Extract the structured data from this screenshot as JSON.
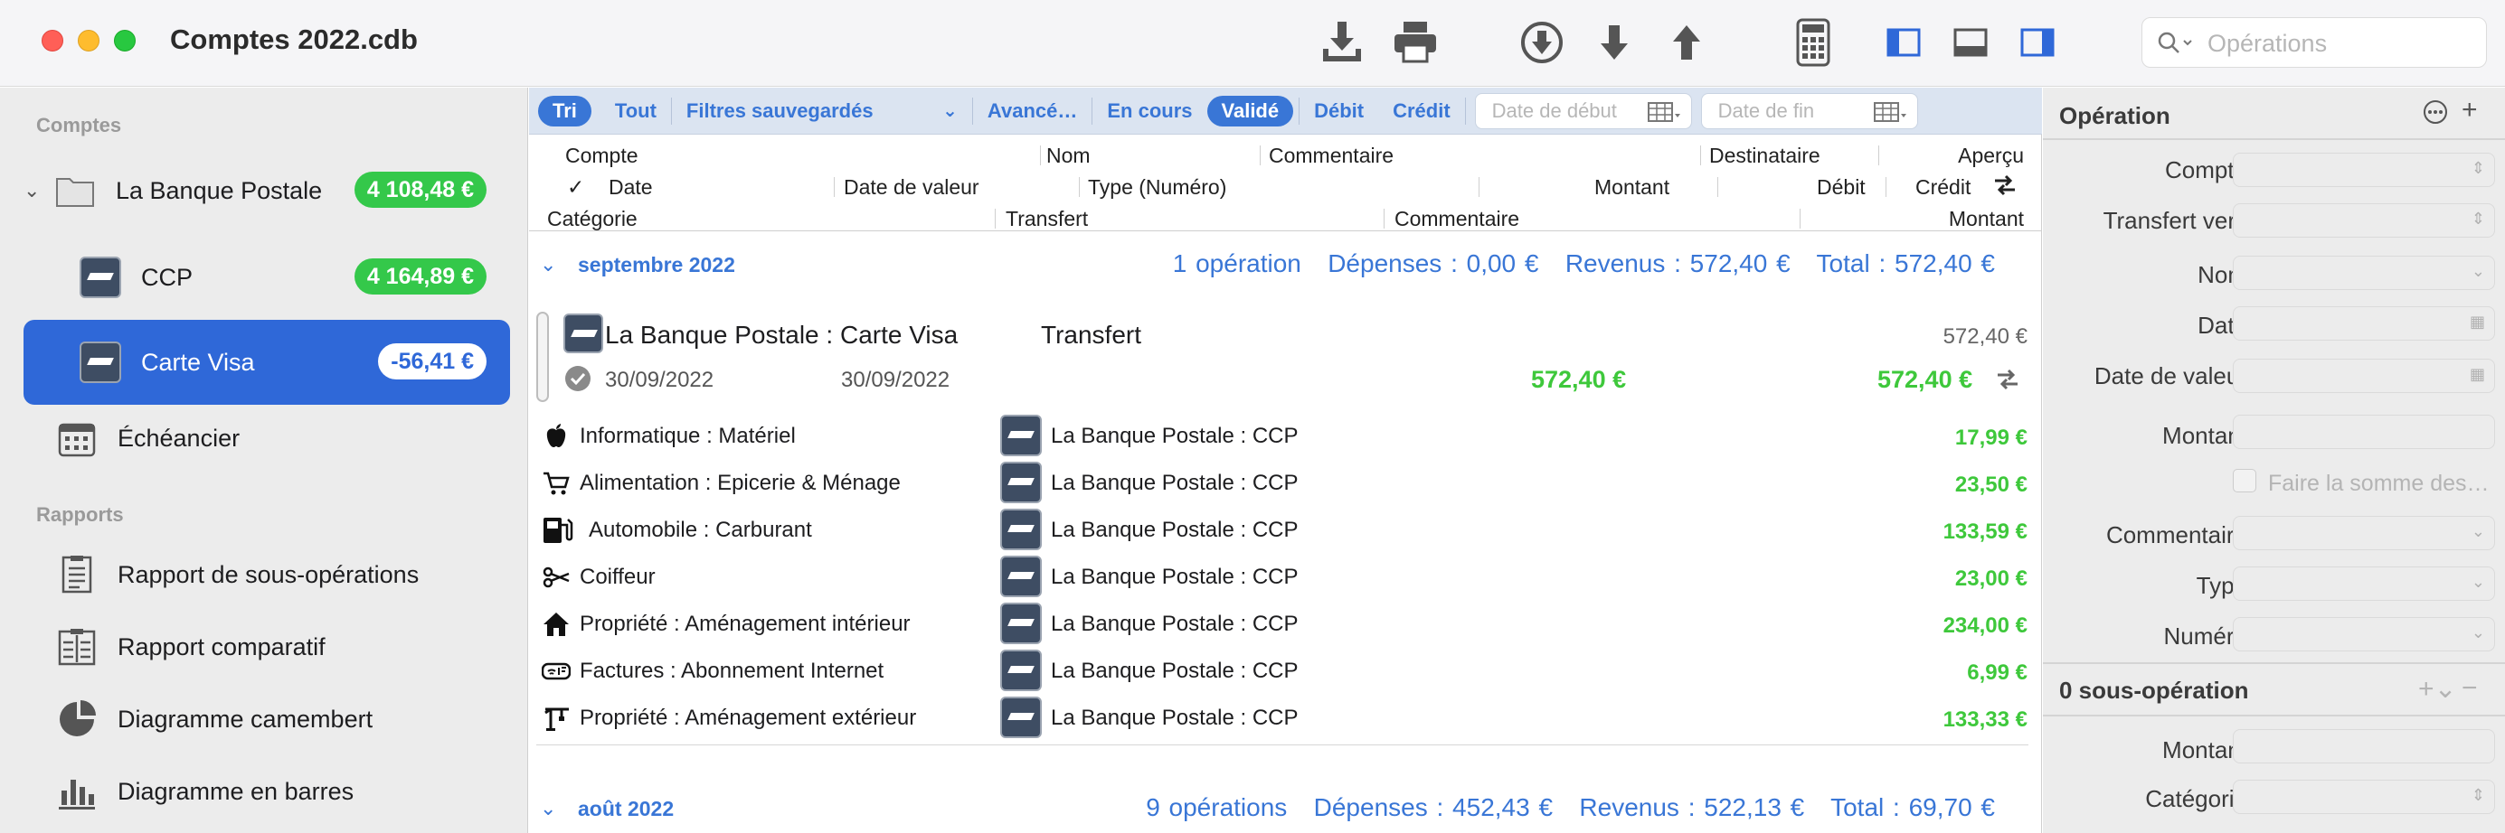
{
  "window": {
    "title": "Comptes 2022.cdb"
  },
  "toolbar": {
    "search_placeholder": "Opérations"
  },
  "sidebar": {
    "accounts_header": "Comptes",
    "reports_header": "Rapports",
    "group": {
      "label": "La Banque Postale",
      "balance": "4 108,48 €"
    },
    "accounts": [
      {
        "label": "CCP",
        "balance": "4 164,89 €"
      },
      {
        "label": "Carte Visa",
        "balance": "-56,41 €"
      }
    ],
    "scheduler": "Échéancier",
    "reports": [
      {
        "label": "Rapport de sous-opérations",
        "icon": "document-list-icon"
      },
      {
        "label": "Rapport comparatif",
        "icon": "compare-report-icon"
      },
      {
        "label": "Diagramme camembert",
        "icon": "pie-chart-icon"
      },
      {
        "label": "Diagramme en barres",
        "icon": "bar-chart-icon"
      }
    ]
  },
  "filters": {
    "tri": "Tri",
    "tout": "Tout",
    "saved": "Filtres sauvegardés",
    "advanced": "Avancé…",
    "en_cours": "En cours",
    "valide": "Validé",
    "debit": "Débit",
    "credit": "Crédit",
    "date_start": "Date de début",
    "date_end": "Date de fin"
  },
  "columns": {
    "compte": "Compte",
    "nom": "Nom",
    "commentaire": "Commentaire",
    "destinataire": "Destinataire",
    "apercu": "Aperçu",
    "check": "✓",
    "date": "Date",
    "date_valeur": "Date de valeur",
    "type": "Type (Numéro)",
    "montant": "Montant",
    "debit": "Débit",
    "credit": "Crédit",
    "categorie": "Catégorie",
    "transfert": "Transfert",
    "commentaire2": "Commentaire",
    "montant2": "Montant"
  },
  "groups": [
    {
      "name": "septembre 2022",
      "count": "1 opération",
      "depenses": "Dépenses : 0,00 €",
      "revenus": "Revenus : 572,40 €",
      "total": "Total : 572,40 €"
    },
    {
      "name": "août 2022",
      "count": "9 opérations",
      "depenses": "Dépenses : 452,43 €",
      "revenus": "Revenus : 522,13 €",
      "total": "Total : 69,70 €"
    }
  ],
  "operation": {
    "account": "La Banque Postale : Carte Visa",
    "name": "Transfert",
    "preview": "572,40 €",
    "date": "30/09/2022",
    "value_date": "30/09/2022",
    "amount": "572,40 €",
    "credit": "572,40 €"
  },
  "splits": [
    {
      "category": "Informatique : Matériel",
      "account": "La Banque Postale : CCP",
      "amount": "17,99 €",
      "icon": "apple-icon"
    },
    {
      "category": "Alimentation : Epicerie & Ménage",
      "account": "La Banque Postale : CCP",
      "amount": "23,50 €",
      "icon": "shopping-cart-icon"
    },
    {
      "category": "Automobile : Carburant",
      "account": "La Banque Postale : CCP",
      "amount": "133,59 €",
      "icon": "fuel-pump-icon"
    },
    {
      "category": "Coiffeur",
      "account": "La Banque Postale : CCP",
      "amount": "23,00 €",
      "icon": "scissors-icon"
    },
    {
      "category": "Propriété : Aménagement intérieur",
      "account": "La Banque Postale : CCP",
      "amount": "234,00 €",
      "icon": "house-icon"
    },
    {
      "category": "Factures : Abonnement Internet",
      "account": "La Banque Postale : CCP",
      "amount": "6,99 €",
      "icon": "wifi-icon"
    },
    {
      "category": "Propriété : Aménagement extérieur",
      "account": "La Banque Postale : CCP",
      "amount": "133,33 €",
      "icon": "crane-icon"
    }
  ],
  "inspector": {
    "title": "Opération",
    "labels": {
      "compte": "Compte",
      "transfert": "Transfert vers",
      "nom": "Nom",
      "date": "Date",
      "date_valeur": "Date de valeur",
      "montant": "Montant",
      "somme": "Faire la somme des…",
      "commentaire": "Commentaire",
      "type": "Type",
      "numero": "Numéro"
    },
    "sub_title": "0 sous-opération",
    "sub_labels": {
      "montant": "Montant",
      "categorie": "Catégorie"
    }
  }
}
